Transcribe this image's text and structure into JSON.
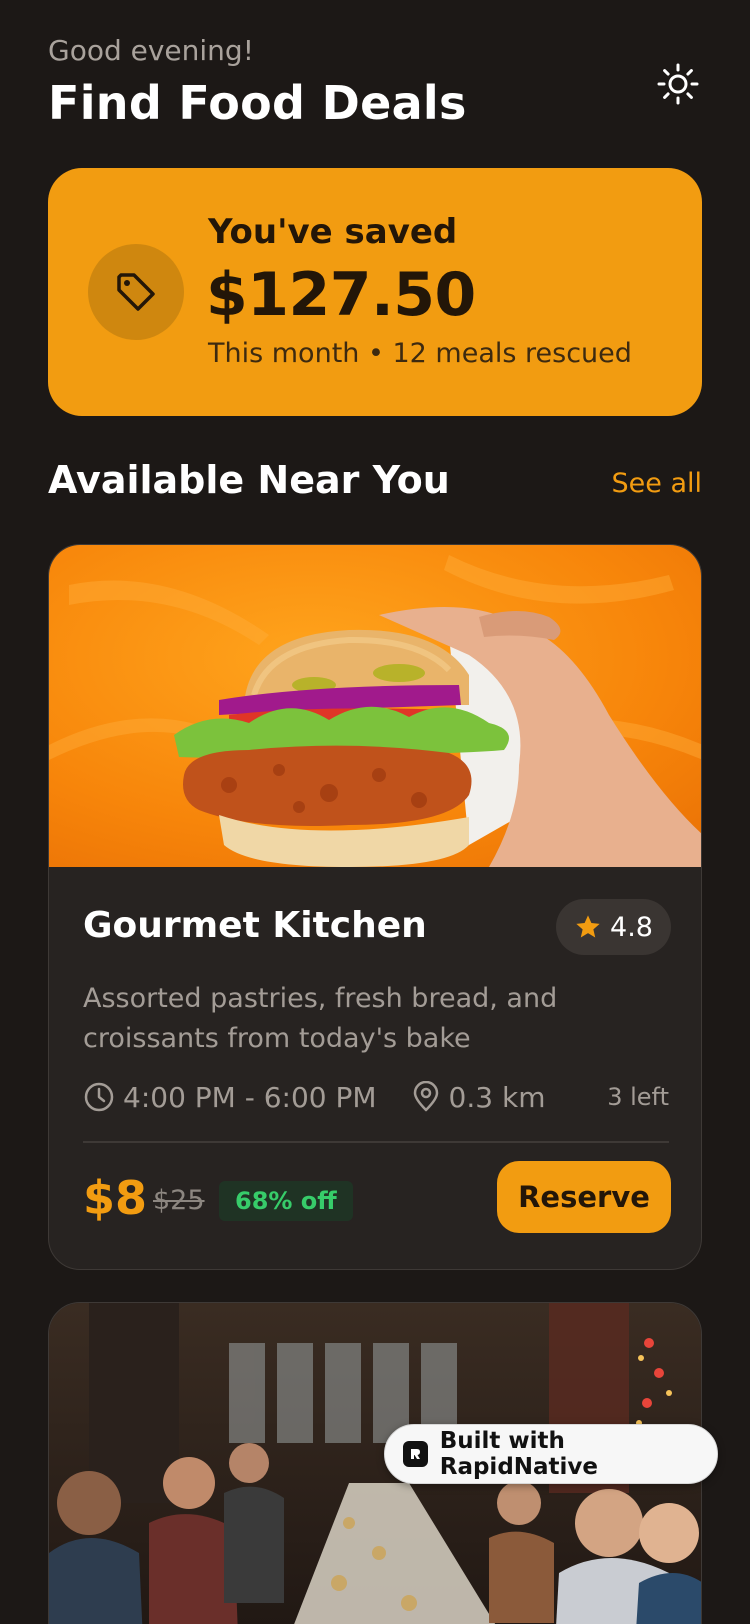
{
  "header": {
    "greeting": "Good evening!",
    "title": "Find Food Deals",
    "theme_icon": "sun-icon"
  },
  "savings": {
    "label": "You've saved",
    "amount": "$127.50",
    "subtitle": "This month • 12 meals rescued",
    "icon": "tag-icon"
  },
  "section": {
    "title": "Available Near You",
    "see_all": "See all"
  },
  "deals": [
    {
      "name": "Gourmet Kitchen",
      "rating": "4.8",
      "description": "Assorted pastries, fresh bread, and croissants from today's bake",
      "time": "4:00 PM - 6:00 PM",
      "distance": "0.3 km",
      "left": "3 left",
      "price": "$8",
      "original_price": "$25",
      "discount": "68% off",
      "reserve_label": "Reserve",
      "image": "chicken-sandwich-photo"
    },
    {
      "image": "dinner-party-photo"
    }
  ],
  "badge": {
    "text": "Built with RapidNative"
  },
  "colors": {
    "background": "#1c1816",
    "accent": "#f29c11",
    "card": "#272321",
    "success": "#37cc6a"
  }
}
